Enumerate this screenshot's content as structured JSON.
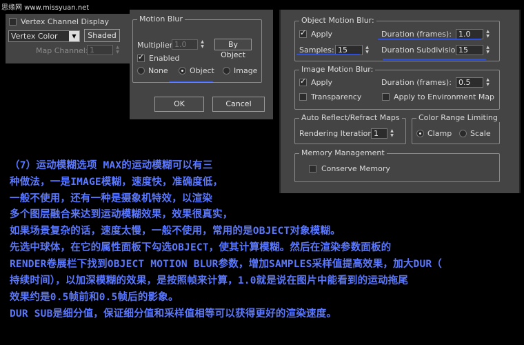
{
  "watermark": "思缘网 www.missyuan.net",
  "left_panel": {
    "vertex_channel_display": "Vertex Channel Display",
    "vertex_color_dropdown": "Vertex Color",
    "shaded_button": "Shaded",
    "map_channel_label": "Map Channel:",
    "map_channel_value": "1"
  },
  "motion_blur_dialog": {
    "group_title": "Motion Blur",
    "multiplier_label": "Multiplier:",
    "multiplier_value": "1.0",
    "by_object_button": "By Object",
    "enabled_label": "Enabled",
    "enabled_checked": true,
    "radio_options": [
      "None",
      "Object",
      "Image"
    ],
    "radio_selected": "Object",
    "ok_button": "OK",
    "cancel_button": "Cancel"
  },
  "render_panel": {
    "object_motion_blur": {
      "title": "Object Motion Blur:",
      "apply_label": "Apply",
      "apply_checked": true,
      "duration_label": "Duration (frames):",
      "duration_value": "1.0",
      "samples_label": "Samples:",
      "samples_value": "15",
      "duration_subdiv_label": "Duration Subdivisions:",
      "duration_subdiv_value": "15"
    },
    "image_motion_blur": {
      "title": "Image Motion Blur:",
      "apply_label": "Apply",
      "apply_checked": true,
      "duration_label": "Duration (frames):",
      "duration_value": "0.5",
      "transparency_label": "Transparency",
      "apply_env_label": "Apply to Environment Map"
    },
    "auto_reflect": {
      "title": "Auto Reflect/Refract Maps",
      "iterations_label": "Rendering Iterations:",
      "iterations_value": "1"
    },
    "color_range": {
      "title": "Color Range Limiting",
      "options": [
        "Clamp",
        "Scale"
      ],
      "selected": "Clamp"
    },
    "memory": {
      "title": "Memory Management",
      "conserve_label": "Conserve Memory"
    }
  },
  "article": {
    "lines": [
      "（7）运动模糊选项   MAX的运动模糊可以有三",
      "种做法，一是IMAGE模糊，速度快，准确度低，",
      "一般不使用，还有一种是摄象机特效，以渲染",
      "多个图层融合来达到运动模糊效果，效果很真实，",
      "如果场景复杂的话，速度太慢，一般不使用，常用的是OBJECT对象模糊。",
      "    先选中球体，在它的属性面板下勾选OBJECT，使其计算模糊。然后在渲染参数面板的",
      "RENDER卷展栏下找到OBJECT MOTION BLUR参数，增加SAMPLES采样值提高效果，加大DUR（",
      "持续时间），以加深模糊的效果，是按照帧来计算，1.0就是说在图片中能看到的运动拖尾",
      "效果约是0.5帧前和0.5帧后的影象。",
      "    DUR SUB是细分值，保证细分值和采样值相等可以获得更好的渲染速度。"
    ]
  },
  "colors": {
    "panel_bg": "#444444",
    "annotation_blue": "#2c4fe0",
    "text_blue": "#5a78ff"
  }
}
